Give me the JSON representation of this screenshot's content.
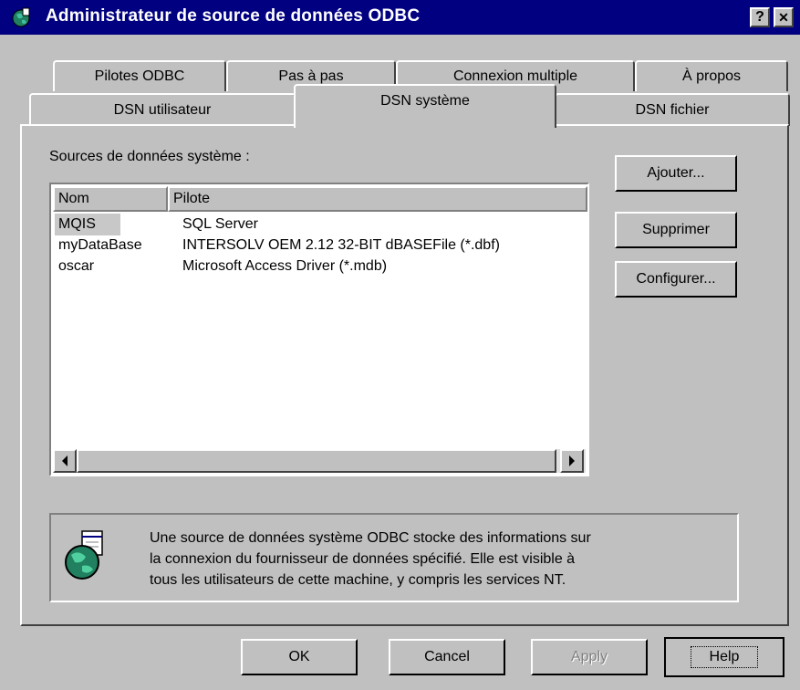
{
  "window": {
    "title": "Administrateur de source de données ODBC",
    "help_btn": "?",
    "close_btn": "✕"
  },
  "tabs": {
    "back_row": [
      "Pilotes ODBC",
      "Pas à pas",
      "Connexion multiple",
      "À propos"
    ],
    "front_row": [
      "DSN utilisateur",
      "DSN système",
      "DSN fichier"
    ],
    "active": "DSN système"
  },
  "main": {
    "list_label": "Sources de données système :",
    "columns": [
      "Nom",
      "Pilote"
    ],
    "rows": [
      {
        "name": "MQIS",
        "driver": "SQL Server"
      },
      {
        "name": "myDataBase",
        "driver": "INTERSOLV OEM 2.12 32-BIT dBASEFile (*.dbf)"
      },
      {
        "name": "oscar",
        "driver": "Microsoft Access Driver (*.mdb)"
      }
    ],
    "selected_row": "MQIS"
  },
  "side_buttons": {
    "add": "Ajouter...",
    "remove": "Supprimer",
    "configure": "Configurer..."
  },
  "info": {
    "line1": "Une source de données système ODBC stocke des informations sur",
    "line2": "la connexion du fournisseur de données spécifié. Elle est visible à",
    "line3": "tous les utilisateurs de cette machine, y compris les services NT."
  },
  "footer": {
    "ok": "OK",
    "cancel": "Cancel",
    "apply": "Apply",
    "help": "Help"
  },
  "colors": {
    "titlebar": "#000080",
    "face": "#c0c0c0",
    "disabled_text": "#808080"
  }
}
